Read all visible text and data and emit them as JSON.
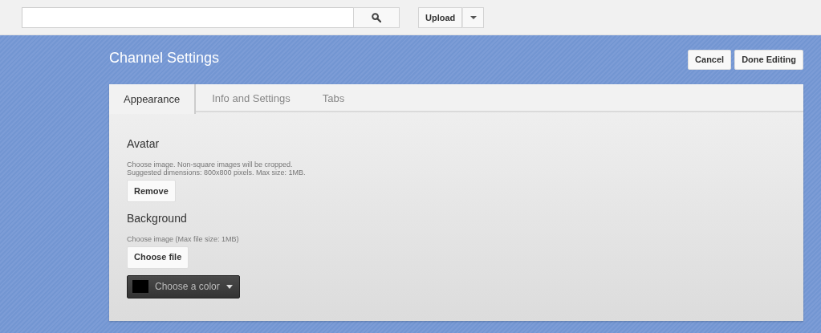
{
  "header": {
    "upload_button": "Upload"
  },
  "page": {
    "title": "Channel Settings",
    "buttons": [
      "Cancel",
      "Done Editing"
    ]
  },
  "tabs": [
    {
      "label": "Appearance",
      "selected": true
    },
    {
      "label": "Info and Settings",
      "selected": false
    },
    {
      "label": "Tabs",
      "selected": false
    }
  ],
  "avatar": {
    "heading": "Avatar",
    "hint_lines": [
      "Choose image. Non-square images will be cropped.",
      "Suggested dimensions: 800x800 pixels. Max size: 1MB."
    ],
    "button": "Remove"
  },
  "background": {
    "heading": "Background",
    "hint": "Choose image (Max file size: 1MB)",
    "button": "Choose file",
    "color_picker": {
      "label": "Choose a color",
      "color": "#000000"
    }
  }
}
